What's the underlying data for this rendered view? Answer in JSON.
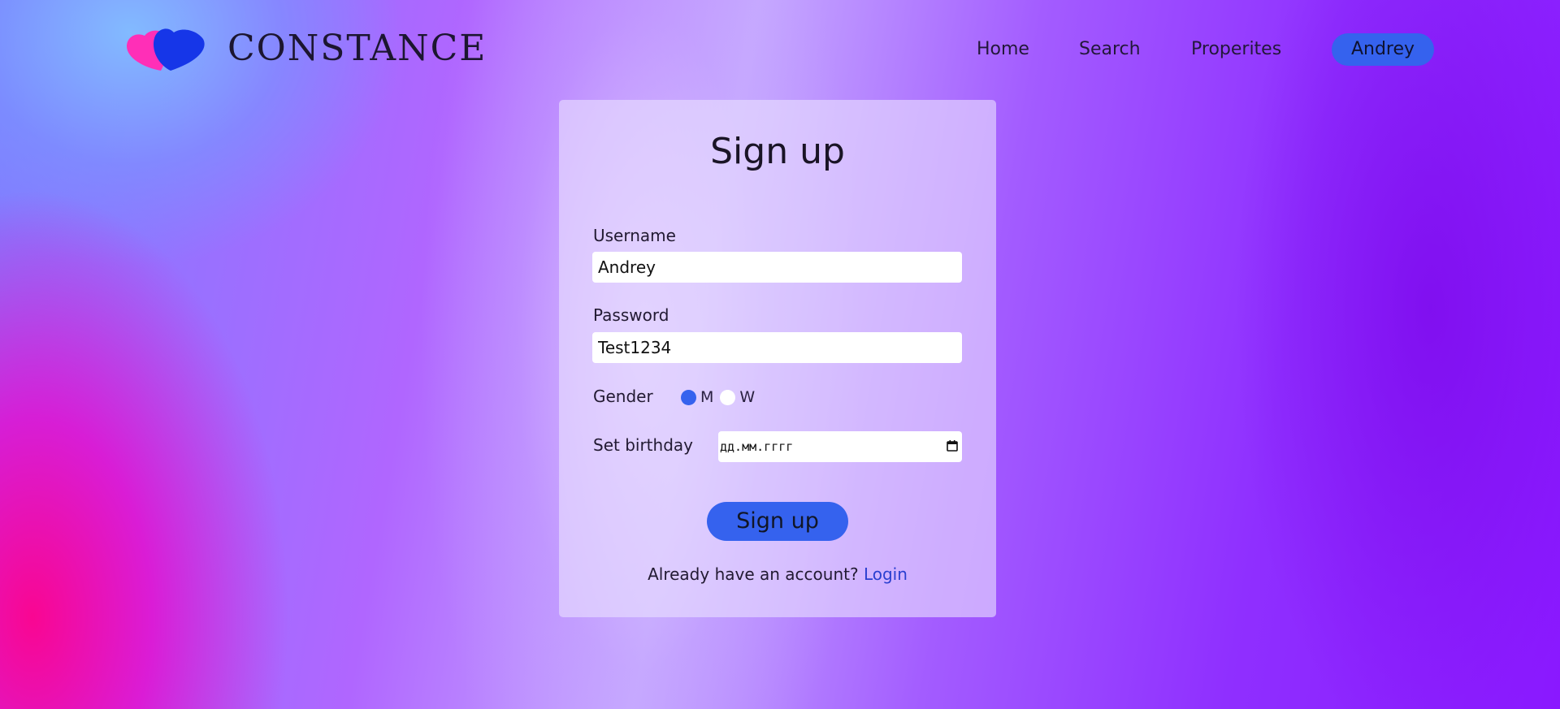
{
  "brand": {
    "name": "CONSTANCE",
    "logo_icon": "two-hearts-icon",
    "logo_colors": [
      "#ff2fb7",
      "#1636e8"
    ]
  },
  "nav": {
    "home": "Home",
    "search": "Search",
    "properites": "Properites",
    "user": "Andrey"
  },
  "form": {
    "title": "Sign up",
    "username": {
      "label": "Username",
      "value": "Andrey"
    },
    "password": {
      "label": "Password",
      "value": "Test1234"
    },
    "gender": {
      "label": "Gender",
      "options": [
        "M",
        "W"
      ],
      "selected": "M"
    },
    "birthday": {
      "label": "Set birthday",
      "placeholder": "дд.мм.гггг",
      "icon": "calendar-icon"
    },
    "submit_label": "Sign up",
    "login_prompt": "Already have an account?",
    "login_link": "Login"
  },
  "colors": {
    "accent": "#3562ee",
    "link": "#2a3fd0"
  }
}
